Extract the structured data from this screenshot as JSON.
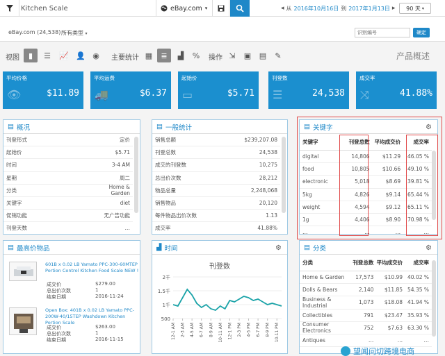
{
  "topbar": {
    "search_value": "Kitchen Scale",
    "site": "eBay.com",
    "date_from_prefix": "从",
    "date_from": "2016年10月16日",
    "date_to_prefix": "到",
    "date_to": "2017年1月13日",
    "days": "90 天"
  },
  "subbar": {
    "shop": "eBay.com (24,538)",
    "category": "所有类型",
    "goods_placeholder": "识别编号",
    "confirm_label": "确定"
  },
  "viewbar": {
    "view_label": "视图",
    "stats_label": "主要统计",
    "ops_label": "操作",
    "overview_label": "产品概述"
  },
  "cards": [
    {
      "label": "平均价格",
      "value": "$11.89",
      "icon": "eye-icon"
    },
    {
      "label": "平均运费",
      "value": "$6.37",
      "icon": "truck-icon"
    },
    {
      "label": "起始价",
      "value": "$5.71",
      "icon": "money-icon"
    },
    {
      "label": "刊登数",
      "value": "24,538",
      "icon": "list-icon"
    },
    {
      "label": "成交率",
      "value": "41.88%",
      "icon": "shuffle-icon"
    }
  ],
  "overview": {
    "title": "概况",
    "rows": [
      {
        "k": "刊登形式",
        "v": "定价"
      },
      {
        "k": "起始价",
        "v": "$5.71"
      },
      {
        "k": "时间",
        "v": "3-4 AM"
      },
      {
        "k": "星期",
        "v": "周二"
      },
      {
        "k": "分类",
        "v": "Home & Garden"
      },
      {
        "k": "关键字",
        "v": "diet"
      },
      {
        "k": "促销功能",
        "v": "无广告功能"
      },
      {
        "k": "刊登天数",
        "v": "…"
      }
    ]
  },
  "general": {
    "title": "一般统计",
    "rows": [
      {
        "k": "销售总额",
        "v": "$239,207.08"
      },
      {
        "k": "刊登总数",
        "v": "24,538"
      },
      {
        "k": "成交的刊登数",
        "v": "10,275"
      },
      {
        "k": "总出价次数",
        "v": "28,212"
      },
      {
        "k": "物品总量",
        "v": "2,248,068"
      },
      {
        "k": "销售物品",
        "v": "20,120"
      },
      {
        "k": "每件物品出价次数",
        "v": "1.13"
      },
      {
        "k": "成交率",
        "v": "41.88%"
      }
    ]
  },
  "keywords": {
    "title": "关键字",
    "headers": [
      "关键字",
      "刊登总数",
      "平均成交价",
      "成交率"
    ],
    "rows": [
      [
        "digital",
        "14,806",
        "$11.29",
        "46.05 %"
      ],
      [
        "food",
        "10,805",
        "$10.66",
        "49.10 %"
      ],
      [
        "electronic",
        "5,018",
        "$8.69",
        "39.81 %"
      ],
      [
        "5kg",
        "4,826",
        "$9.14",
        "65.44 %"
      ],
      [
        "weight",
        "4,594",
        "$9.12",
        "65.11 %"
      ],
      [
        "1g",
        "4,406",
        "$8.90",
        "70.98 %"
      ],
      [
        "…",
        "…",
        "…",
        "…"
      ]
    ]
  },
  "top_items": {
    "title": "最高价物品",
    "items": [
      {
        "title": "601B x 0.02 LB Yamato PPC-300-60MTEP Portion Control Kitchen Food Scale NEW !",
        "details": [
          [
            "成交价",
            "$279.00"
          ],
          [
            "总出价次数",
            "1"
          ],
          [
            "结束日期",
            "2016-11-24"
          ]
        ]
      },
      {
        "title": "Open Box: 401B x 0.02 LB Yamato PPC-200W-40/15TEP Washdown Kitchen Portion Scale",
        "details": [
          [
            "成交价",
            "$263.00"
          ],
          [
            "总出价次数",
            "1"
          ],
          [
            "结束日期",
            "2016-11-15"
          ]
        ]
      }
    ]
  },
  "time_panel": {
    "title": "时间",
    "chart_title": "刊登数"
  },
  "chart_data": {
    "type": "line",
    "title": "刊登数",
    "categories": [
      "12-1 AM",
      "2-3 AM",
      "4-5 AM",
      "6-7 AM",
      "8-9 AM",
      "10-11 AM",
      "12-1 PM",
      "2-3 PM",
      "4-5 PM",
      "6-7 PM",
      "8-9 PM",
      "10-11 PM"
    ],
    "x": [
      "12-1 AM",
      "1-2 AM",
      "2-3 AM",
      "3-4 AM",
      "4-5 AM",
      "5-6 AM",
      "6-7 AM",
      "7-8 AM",
      "8-9 AM",
      "9-10 AM",
      "10-11 AM",
      "11-12 AM",
      "12-1 PM",
      "1-2 PM",
      "2-3 PM",
      "3-4 PM",
      "4-5 PM",
      "5-6 PM",
      "6-7 PM",
      "7-8 PM",
      "8-9 PM",
      "9-10 PM",
      "10-11 PM",
      "11-12 PM"
    ],
    "values": [
      1000,
      950,
      1250,
      1550,
      1350,
      1050,
      900,
      1000,
      850,
      800,
      950,
      850,
      1150,
      1100,
      1200,
      1300,
      1250,
      1150,
      1200,
      1100,
      1000,
      1050,
      1000,
      950
    ],
    "yticks": [
      "500",
      "1千",
      "1.5千",
      "2千"
    ],
    "ylim": [
      500,
      2000
    ]
  },
  "categories": {
    "title": "分类",
    "headers": [
      "分类",
      "刊登总数",
      "平均成交价",
      "成交率"
    ],
    "rows": [
      [
        "Home & Garden",
        "17,573",
        "$10.99",
        "40.02 %"
      ],
      [
        "Dolls & Bears",
        "2,140",
        "$11.85",
        "54.35 %"
      ],
      [
        "Business & Industrial",
        "1,073",
        "$18.08",
        "41.94 %"
      ],
      [
        "Collectibles",
        "791",
        "$23.47",
        "35.93 %"
      ],
      [
        "Consumer Electronics",
        "752",
        "$7.63",
        "63.30 %"
      ],
      [
        "Antiques",
        "…",
        "…",
        "…"
      ]
    ]
  },
  "watermark": "望闻问切跨境电商"
}
